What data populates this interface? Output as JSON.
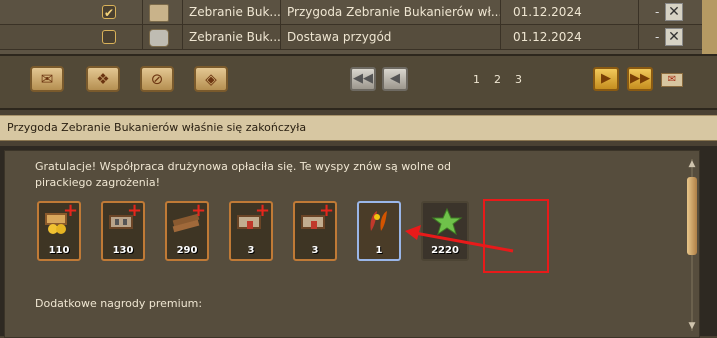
{
  "messages": [
    {
      "checked": true,
      "icon": "map-scroll-icon",
      "sender": "Zebranie Buk...",
      "subject": "Przygoda Zebranie Bukanierów wł...",
      "date": "01.12.2024",
      "dash": "-"
    },
    {
      "checked": false,
      "icon": "treasure-chest-icon",
      "sender": "Zebranie Buk...",
      "subject": "Dostawa przygód",
      "date": "01.12.2024",
      "dash": "-"
    }
  ],
  "toolbar": {
    "pages": [
      "1",
      "2",
      "3"
    ]
  },
  "message": {
    "title": "Przygoda Zebranie Bukanierów właśnie się zakończyła",
    "body": "Gratulacje! Współpraca drużynowa opłaciła się. Te wyspy znów są wolne od pirackiego zagrożenia!",
    "rewards": [
      {
        "icon": "gold-coins-buff-icon",
        "count": "110"
      },
      {
        "icon": "tools-buff-icon",
        "count": "130"
      },
      {
        "icon": "wood-buff-icon",
        "count": "290"
      },
      {
        "icon": "building-buff-icon",
        "count": "3"
      },
      {
        "icon": "building-buff-icon",
        "count": "3"
      },
      {
        "icon": "red-feathers-icon",
        "count": "1"
      },
      {
        "icon": "green-star-xp-icon",
        "count": "2220"
      }
    ],
    "premium_label": "Dodatkowe nagrody premium:"
  },
  "colors": {
    "highlight_box": "#e81a1a",
    "header_bar": "#d7c7a2",
    "reward_border": "#c07a36"
  }
}
